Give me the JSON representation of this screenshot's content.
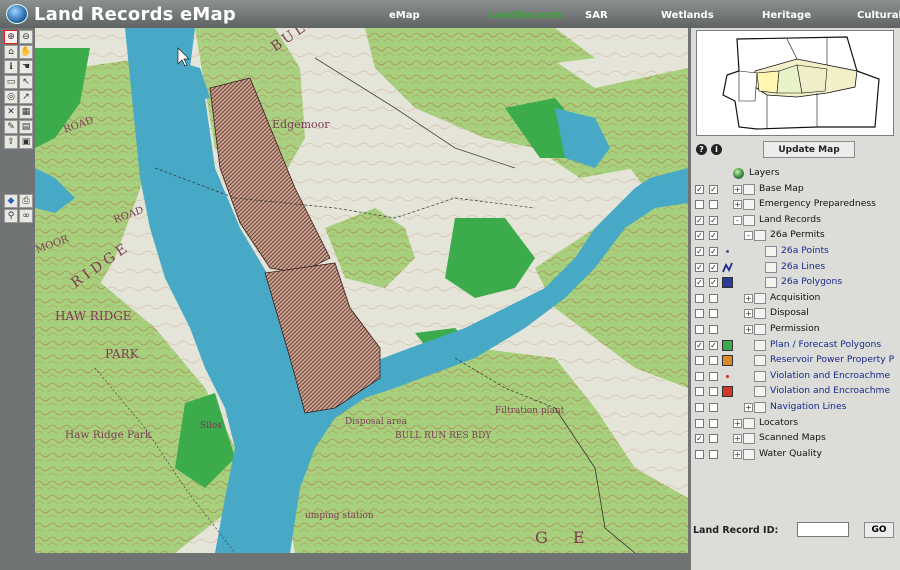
{
  "app": {
    "title": "Land Records eMap"
  },
  "nav": {
    "items": [
      {
        "label": "eMap",
        "active": false
      },
      {
        "label": "LandRecords",
        "active": true
      },
      {
        "label": "SAR",
        "active": false
      },
      {
        "label": "Wetlands",
        "active": false
      },
      {
        "label": "Heritage",
        "active": false
      },
      {
        "label": "Cultural",
        "active": false
      }
    ]
  },
  "toolbar": {
    "tools": [
      "zoom-in",
      "zoom-out",
      "zoom-full",
      "pan",
      "identify",
      "select-hand",
      "select-box",
      "pointer",
      "buffer",
      "measure",
      "clear",
      "erase",
      "print-preview",
      "query",
      "export",
      "save",
      "layers",
      "print"
    ]
  },
  "map": {
    "labels": {
      "edgemoor": "Edgemoor",
      "bullrun": "BULL RUN",
      "road_left": "ROAD",
      "ridge": "RIDGE",
      "haw_ridge": "HAW RIDGE",
      "park": "PARK",
      "haw_ridge_park": "Haw Ridge Park",
      "silos": "Silos",
      "disposal_area": "Disposal area",
      "filtration_plant": "Filtration plant",
      "pumping_station": "umping station",
      "bull_run_res": "BULL RUN RES BDY",
      "road2": "ROAD",
      "ge": "G E",
      "moor": "MOOR"
    },
    "colors": {
      "water": "#47a9c6",
      "vegetation": "#a6d07c",
      "marsh": "#3cab4b",
      "paper": "#e4e4d8",
      "contour": "#b57b55"
    }
  },
  "panel": {
    "update_button": "Update Map",
    "layers_root": "Layers",
    "layers": [
      {
        "label": "Base Map",
        "indent": 1,
        "vis": true,
        "lab": true,
        "tree": "+",
        "kind": "folder"
      },
      {
        "label": "Emergency Preparedness",
        "indent": 1,
        "vis": false,
        "lab": false,
        "tree": "+",
        "kind": "folder"
      },
      {
        "label": "Land Records",
        "indent": 1,
        "vis": true,
        "lab": true,
        "tree": "-",
        "kind": "folder"
      },
      {
        "label": "26a Permits",
        "indent": 2,
        "vis": true,
        "lab": true,
        "tree": "-",
        "kind": "folder"
      },
      {
        "label": "26a Points",
        "indent": 3,
        "vis": true,
        "lab": true,
        "tree": "",
        "kind": "layer",
        "link": true,
        "swatch": "dot",
        "color": "#555577"
      },
      {
        "label": "26a Lines",
        "indent": 3,
        "vis": true,
        "lab": true,
        "tree": "",
        "kind": "layer",
        "link": true,
        "swatch": "line",
        "color": "#1c2e8a"
      },
      {
        "label": "26a Polygons",
        "indent": 3,
        "vis": true,
        "lab": true,
        "tree": "",
        "kind": "layer",
        "link": true,
        "swatch": "box",
        "color": "#2c3a9c"
      },
      {
        "label": "Acquisition",
        "indent": 2,
        "vis": false,
        "lab": false,
        "tree": "+",
        "kind": "folder"
      },
      {
        "label": "Disposal",
        "indent": 2,
        "vis": false,
        "lab": false,
        "tree": "+",
        "kind": "folder"
      },
      {
        "label": "Permission",
        "indent": 2,
        "vis": false,
        "lab": false,
        "tree": "+",
        "kind": "folder"
      },
      {
        "label": "Plan / Forecast Polygons",
        "indent": 2,
        "vis": true,
        "lab": true,
        "tree": "",
        "kind": "layer",
        "link": true,
        "swatch": "box",
        "color": "#3cab4b"
      },
      {
        "label": "Reservoir Power Property P",
        "indent": 2,
        "vis": false,
        "lab": false,
        "tree": "",
        "kind": "layer",
        "link": true,
        "swatch": "box",
        "color": "#d98a2a"
      },
      {
        "label": "Violation and Encroachme",
        "indent": 2,
        "vis": false,
        "lab": false,
        "tree": "",
        "kind": "layer",
        "link": true,
        "swatch": "dot",
        "color": "#cc2222"
      },
      {
        "label": "Violation and Encroachme",
        "indent": 2,
        "vis": false,
        "lab": false,
        "tree": "",
        "kind": "layer",
        "link": true,
        "swatch": "box",
        "color": "#d43a2a"
      },
      {
        "label": "Navigation Lines",
        "indent": 2,
        "vis": false,
        "lab": false,
        "tree": "+",
        "kind": "folder",
        "link": true
      },
      {
        "label": "Locators",
        "indent": 1,
        "vis": false,
        "lab": false,
        "tree": "+",
        "kind": "folder"
      },
      {
        "label": "Scanned Maps",
        "indent": 1,
        "vis": true,
        "lab": false,
        "tree": "+",
        "kind": "folder"
      },
      {
        "label": "Water Quality",
        "indent": 1,
        "vis": false,
        "lab": false,
        "tree": "+",
        "kind": "folder"
      }
    ],
    "record_id_label": "Land Record ID:",
    "record_id_value": "",
    "go_button": "GO"
  }
}
